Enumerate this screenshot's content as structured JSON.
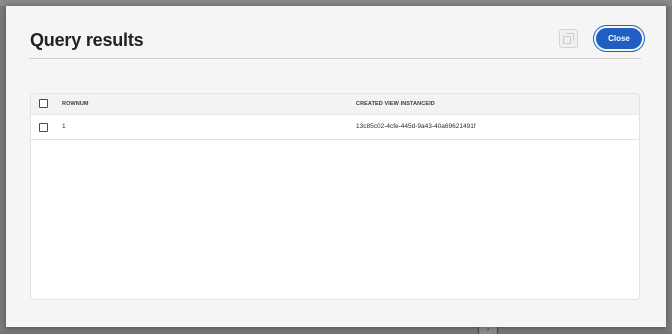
{
  "dialog": {
    "title": "Query results",
    "close_label": "Close",
    "download_icon": "download-icon"
  },
  "table": {
    "columns": [
      "ROWNUM",
      "CREATED VIEW INSTANCEID"
    ],
    "rows": [
      {
        "rownum": "1",
        "instance_id": "13c85c02-4cfe-445d-9a43-40a69621491f"
      }
    ]
  },
  "colors": {
    "accent": "#1f5fc4",
    "modal_bg": "#f5f5f5",
    "backdrop": "#6c6c6c"
  }
}
